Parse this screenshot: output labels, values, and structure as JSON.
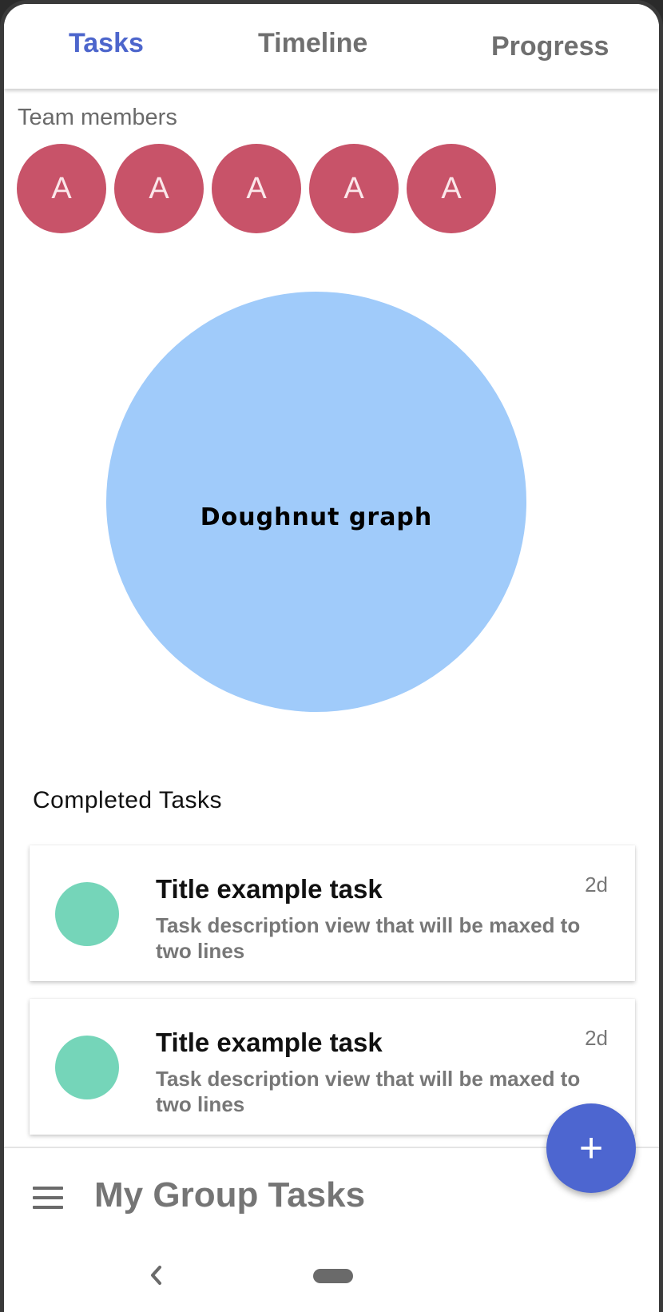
{
  "tabs": [
    {
      "label": "Tasks",
      "active": true
    },
    {
      "label": "Timeline",
      "active": false
    },
    {
      "label": "Progress",
      "active": false
    }
  ],
  "team": {
    "label": "Team members",
    "members": [
      "A",
      "A",
      "A",
      "A",
      "A"
    ]
  },
  "graph": {
    "label": "Doughnut graph"
  },
  "completed": {
    "title": "Completed Tasks",
    "tasks": [
      {
        "title": "Title example task",
        "description": "Task description view that will be maxed to two lines",
        "time": "2d"
      },
      {
        "title": "Title example task",
        "description": "Task description view that will be maxed to two lines",
        "time": "2d"
      }
    ]
  },
  "bottom": {
    "title": "My Group Tasks",
    "fab_label": "+"
  },
  "colors": {
    "accent": "#4d66cc",
    "avatar": "#c85369",
    "graph": "#a0cbfa",
    "task_dot": "#75d5b9"
  },
  "icons": {
    "menu": "menu-icon",
    "back": "back-icon",
    "home": "home-pill-icon"
  }
}
